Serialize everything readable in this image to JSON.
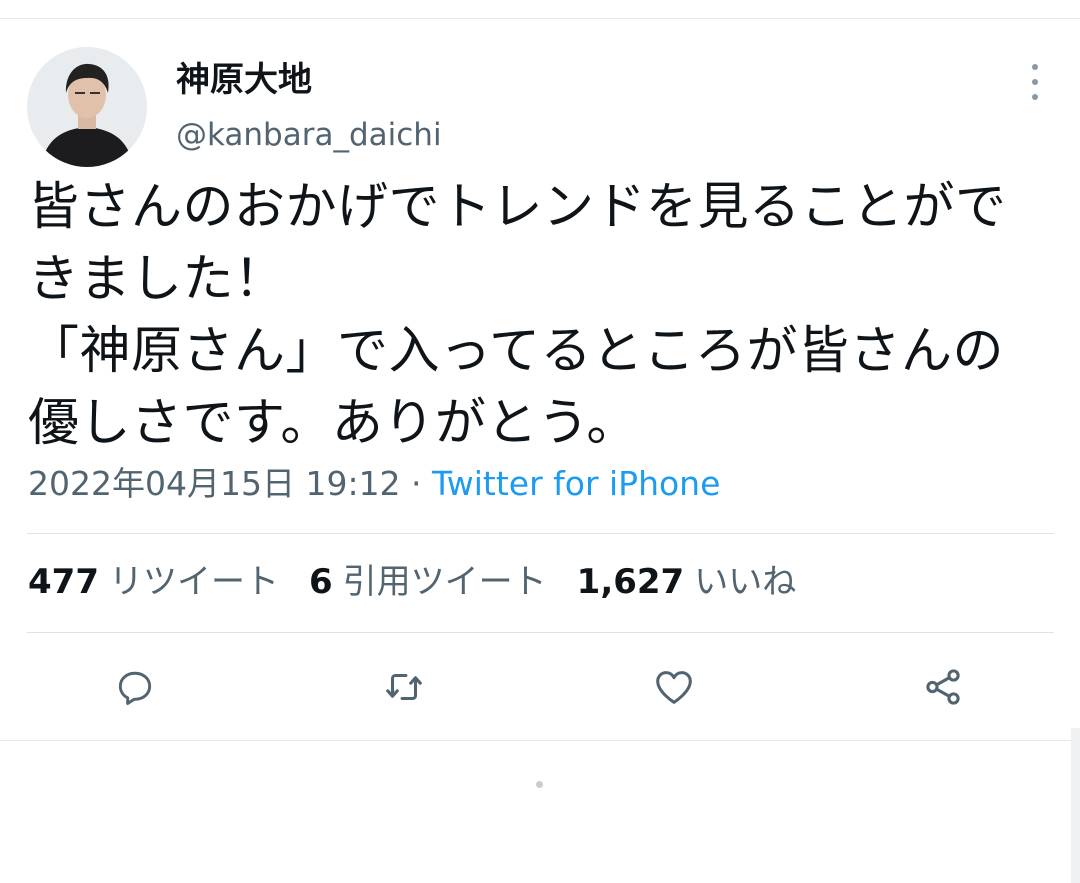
{
  "tweet": {
    "author": {
      "display_name": "神原大地",
      "handle": "@kanbara_daichi",
      "avatar_icon": "profile-photo"
    },
    "text": "皆さんのおかげでトレンドを見ることができました！\n「神原さん」で入ってるところが皆さんの優しさです。ありがとう。",
    "timestamp": "2022年04月15日 19:12",
    "separator": " · ",
    "source": "Twitter for iPhone",
    "stats": [
      {
        "count": "477",
        "label": "リツイート"
      },
      {
        "count": "6",
        "label": "引用ツイート"
      },
      {
        "count": "1,627",
        "label": "いいね"
      }
    ],
    "actions": [
      "reply-icon",
      "retweet-icon",
      "like-icon",
      "share-icon"
    ]
  },
  "colors": {
    "text_primary": "#0f1419",
    "text_secondary": "#536471",
    "link": "#1d9bf0",
    "icon": "#536471",
    "divider": "#dfe3e6"
  }
}
